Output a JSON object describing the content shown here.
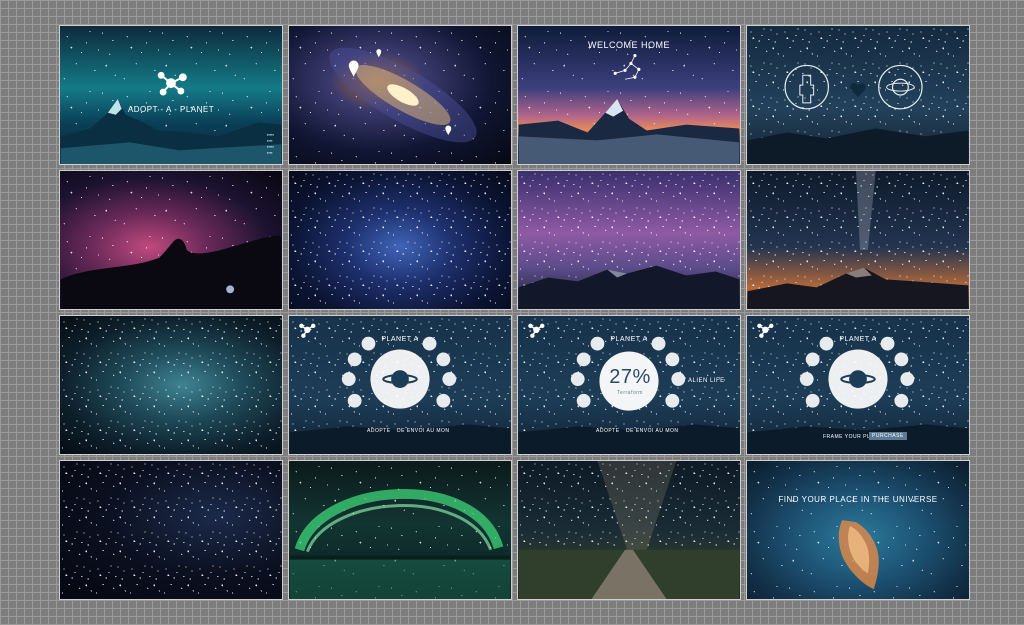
{
  "tiles": {
    "adopt": {
      "brand": "ADOPT - A - PLANET",
      "menu": [
        "▪▪▪▪▪",
        "▪▪▪▪",
        "▪▪▪▪▪",
        "▪▪▪▪"
      ]
    },
    "welcome": {
      "title": "WELCOME HOME"
    },
    "planet_menu_1": {
      "title": "PLANET A",
      "left_label": "ADOPTE",
      "right_label": "DE ENVOI AU MON"
    },
    "planet_menu_2": {
      "title": "PLANET A",
      "percent": "27%",
      "sub": "Terraform",
      "side_label": "ALIEN LIFE",
      "left_label": "ADOPTE",
      "right_label": "DE ENVOI AU MON"
    },
    "planet_menu_3": {
      "title": "PLANET A",
      "footer_text": "FRAME YOUR PLANET",
      "purchase": "PURCHASE"
    },
    "universe": {
      "headline": "FIND YOUR PLACE IN THE UNIVERSE"
    }
  }
}
